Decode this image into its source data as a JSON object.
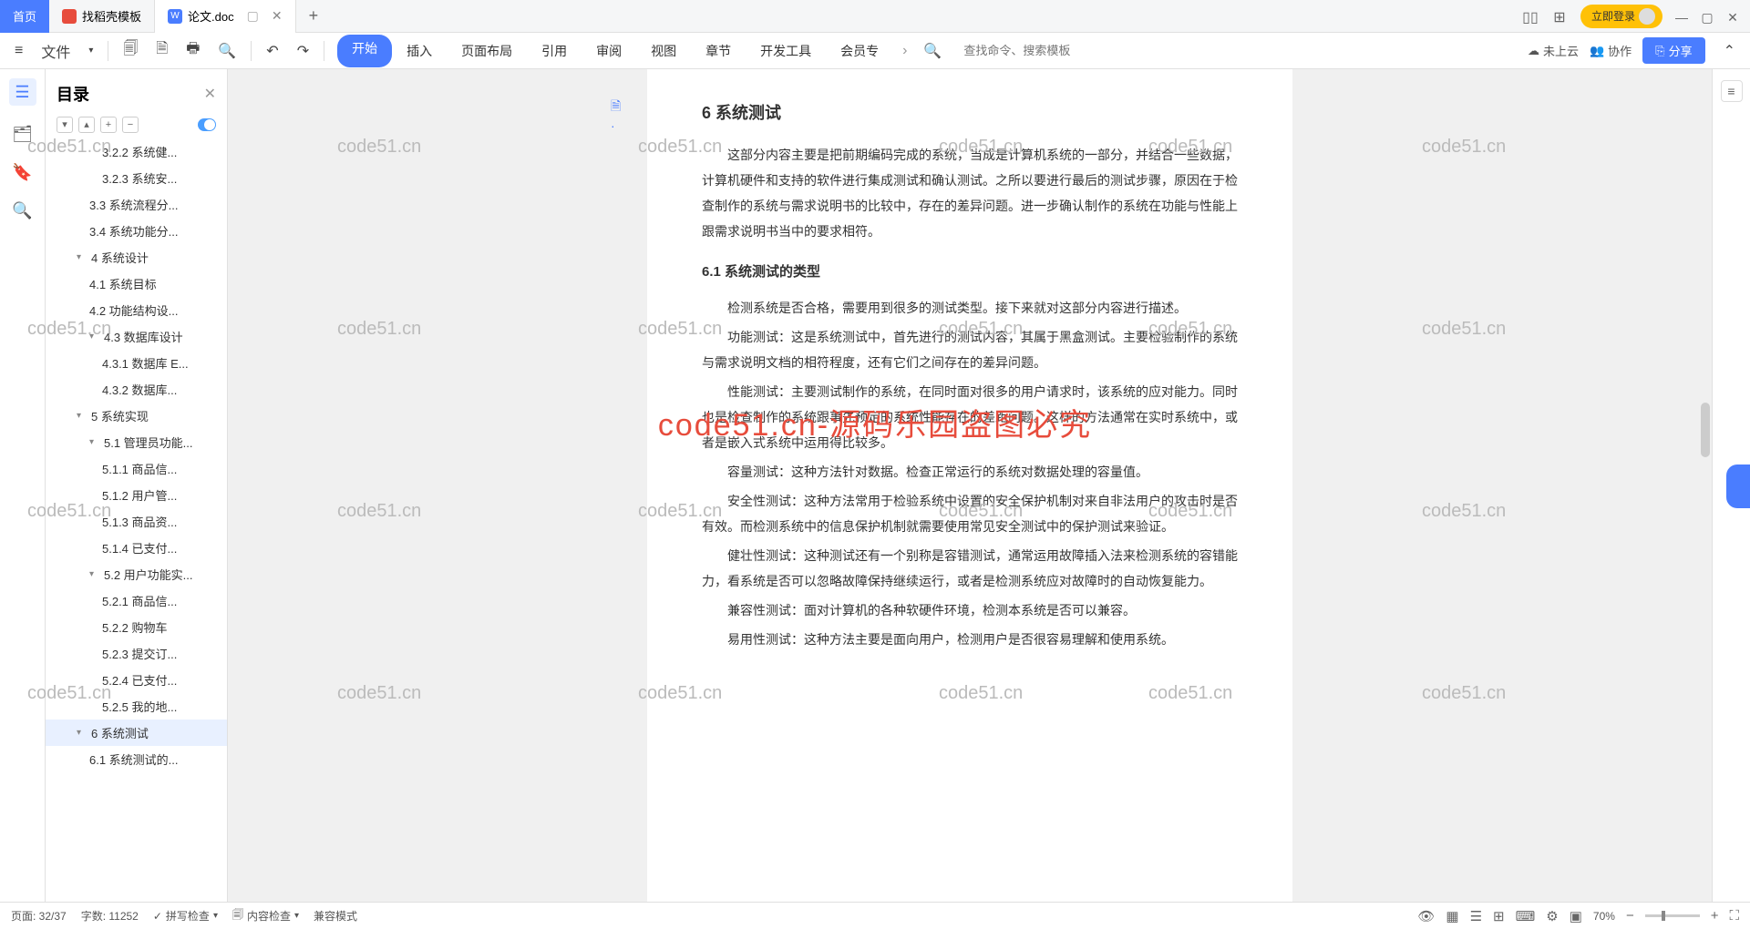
{
  "titlebar": {
    "home": "首页",
    "tab_template": "找稻壳模板",
    "tab_doc": "论文.doc",
    "login": "立即登录"
  },
  "toolbar": {
    "file": "文件",
    "menu": {
      "start": "开始",
      "insert": "插入",
      "layout": "页面布局",
      "reference": "引用",
      "review": "审阅",
      "view": "视图",
      "chapter": "章节",
      "devtools": "开发工具",
      "member": "会员专"
    },
    "search_placeholder": "查找命令、搜索模板",
    "cloud": "未上云",
    "collab": "协作",
    "share": "分享"
  },
  "outline": {
    "title": "目录",
    "items": [
      {
        "lvl": 4,
        "text": "3.2.2 系统健...",
        "ch": ""
      },
      {
        "lvl": 4,
        "text": "3.2.3 系统安...",
        "ch": ""
      },
      {
        "lvl": 3,
        "text": "3.3 系统流程分...",
        "ch": ""
      },
      {
        "lvl": 3,
        "text": "3.4 系统功能分...",
        "ch": ""
      },
      {
        "lvl": 2,
        "text": "4 系统设计",
        "ch": "▾"
      },
      {
        "lvl": 3,
        "text": "4.1 系统目标",
        "ch": ""
      },
      {
        "lvl": 3,
        "text": "4.2 功能结构设...",
        "ch": ""
      },
      {
        "lvl": 3,
        "text": "4.3 数据库设计",
        "ch": "▾"
      },
      {
        "lvl": 4,
        "text": "4.3.1 数据库 E...",
        "ch": ""
      },
      {
        "lvl": 4,
        "text": "4.3.2 数据库...",
        "ch": ""
      },
      {
        "lvl": 2,
        "text": "5 系统实现",
        "ch": "▾"
      },
      {
        "lvl": 3,
        "text": "5.1 管理员功能...",
        "ch": "▾"
      },
      {
        "lvl": 4,
        "text": "5.1.1 商品信...",
        "ch": ""
      },
      {
        "lvl": 4,
        "text": "5.1.2 用户管...",
        "ch": ""
      },
      {
        "lvl": 4,
        "text": "5.1.3 商品资...",
        "ch": ""
      },
      {
        "lvl": 4,
        "text": "5.1.4 已支付...",
        "ch": ""
      },
      {
        "lvl": 3,
        "text": "5.2 用户功能实...",
        "ch": "▾"
      },
      {
        "lvl": 4,
        "text": "5.2.1 商品信...",
        "ch": ""
      },
      {
        "lvl": 4,
        "text": "5.2.2 购物车",
        "ch": ""
      },
      {
        "lvl": 4,
        "text": "5.2.3 提交订...",
        "ch": ""
      },
      {
        "lvl": 4,
        "text": "5.2.4 已支付...",
        "ch": ""
      },
      {
        "lvl": 4,
        "text": "5.2.5 我的地...",
        "ch": ""
      },
      {
        "lvl": 2,
        "text": "6 系统测试",
        "ch": "▾",
        "active": true
      },
      {
        "lvl": 3,
        "text": "6.1 系统测试的...",
        "ch": ""
      }
    ]
  },
  "document": {
    "h1": "6 系统测试",
    "intro": "这部分内容主要是把前期编码完成的系统，当成是计算机系统的一部分，并结合一些数据，计算机硬件和支持的软件进行集成测试和确认测试。之所以要进行最后的测试步骤，原因在于检查制作的系统与需求说明书的比较中，存在的差异问题。进一步确认制作的系统在功能与性能上跟需求说明书当中的要求相符。",
    "h2": "6.1 系统测试的类型",
    "p1": "检测系统是否合格，需要用到很多的测试类型。接下来就对这部分内容进行描述。",
    "p2": "功能测试：这是系统测试中，首先进行的测试内容，其属于黑盒测试。主要检验制作的系统与需求说明文档的相符程度，还有它们之间存在的差异问题。",
    "p3": "性能测试：主要测试制作的系统，在同时面对很多的用户请求时，该系统的应对能力。同时也是检查制作的系统跟事先预定的系统性能存在的差距问题。这样的方法通常在实时系统中，或者是嵌入式系统中运用得比较多。",
    "p4": "容量测试：这种方法针对数据。检查正常运行的系统对数据处理的容量值。",
    "p5": "安全性测试：这种方法常用于检验系统中设置的安全保护机制对来自非法用户的攻击时是否有效。而检测系统中的信息保护机制就需要使用常见安全测试中的保护测试来验证。",
    "p6": "健壮性测试：这种测试还有一个别称是容错测试，通常运用故障插入法来检测系统的容错能力，看系统是否可以忽略故障保持继续运行，或者是检测系统应对故障时的自动恢复能力。",
    "p7": "兼容性测试：面对计算机的各种软硬件环境，检测本系统是否可以兼容。",
    "p8": "易用性测试：这种方法主要是面向用户，检测用户是否很容易理解和使用系统。"
  },
  "statusbar": {
    "page": "页面: 32/37",
    "words": "字数: 11252",
    "spell": "拼写检查",
    "content": "内容检查",
    "compat": "兼容模式",
    "zoom": "70%"
  },
  "watermark": {
    "text": "code51.cn",
    "red": "code51.cn-源码乐园盗图必究"
  }
}
